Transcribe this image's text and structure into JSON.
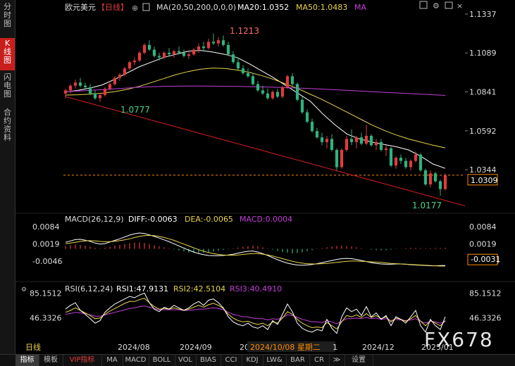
{
  "sidebar": {
    "items": [
      {
        "label": "分\n时\n图",
        "active": false
      },
      {
        "label": "K\n线\n图",
        "active": true
      },
      {
        "label": "闪\n电\n图",
        "active": false
      },
      {
        "label": "合\n约\n资\n料",
        "active": false
      }
    ]
  },
  "header": {
    "symbol": "欧元美元",
    "period": "【日线】",
    "ma_text": "MA(20,50,200,0,0,0)",
    "ma20_text": "MA20:1.0352",
    "ma50_text": "MA50:1.0483",
    "ma200_text": "MA"
  },
  "macd_header": {
    "title": "MACD(26,12,9)",
    "diff": "DIFF:-0.0063",
    "dea": "DEA:-0.0065",
    "macd": "MACD:0.0004"
  },
  "rsi_header": {
    "title": "RSI(6,12,24)",
    "rsi1": "RSI1:47.9131",
    "rsi2": "RSI2:42.5104",
    "rsi3": "RSI3:40.4910"
  },
  "price_axis": {
    "ticks": [
      "1.1337",
      "1.1089",
      "1.0841",
      "1.0592",
      "1.0344"
    ],
    "tick_values": [
      1.1337,
      1.1089,
      1.0841,
      1.0592,
      1.0344
    ],
    "current": "1.0309",
    "current_value": 1.0309
  },
  "macd_axis": {
    "ticks": [
      "0.0084",
      "0.0019",
      "-0.0046"
    ],
    "tick_values": [
      0.0084,
      0.0019,
      -0.0046
    ],
    "current": "-0.0031"
  },
  "rsi_axis": {
    "ticks": [
      "85.1512",
      "46.3326"
    ],
    "tick_values": [
      85.1512,
      46.3326
    ]
  },
  "annotations": {
    "high": "1.1213",
    "low_mid": "1.0777",
    "low_end": "1.0177"
  },
  "time_axis": {
    "labels": [
      "2024/08",
      "2024/09",
      "20",
      "2024/10/08 星期二",
      "1",
      "2024/12",
      "2025/01"
    ]
  },
  "cursor_date": "2024/10/08 星期二",
  "period_label": "日线",
  "watermark": "FX678",
  "bottom_tabs": [
    "指标",
    "模板",
    "VIP指标",
    "MA",
    "MACD",
    "BOLL",
    "VOL",
    "BIAS",
    "CCI",
    "KDJ",
    "LW&",
    "BAR",
    "CR",
    "≫",
    "设置"
  ],
  "colors": {
    "up": "#e23b3b",
    "down": "#2fb37e",
    "ma20": "#ffffff",
    "ma50": "#e8d44a",
    "ma200": "#c23fd9",
    "trend": "#e02020",
    "cursor": "#ff8a00",
    "annotation_high": "#ff6b6b",
    "annotation_low": "#4ad48a",
    "current_box": "#ff8a00"
  },
  "chart_data": {
    "type": "candlestick",
    "price_range": [
      1.0115,
      1.1337
    ],
    "macd_range": [
      -0.0065,
      0.0084
    ],
    "rsi_range": [
      15,
      90
    ],
    "grid": false,
    "series": [
      {
        "name": "MA20",
        "values": [
          1.084,
          1.085,
          1.0865,
          1.0885,
          1.092,
          1.096,
          1.1,
          1.103,
          1.106,
          1.108,
          1.11,
          1.1105,
          1.1095,
          1.108,
          1.106,
          1.102,
          1.0975,
          1.093,
          1.088,
          1.083,
          1.078,
          1.07,
          1.063,
          1.057,
          1.054,
          1.052,
          1.0505,
          1.049,
          1.047,
          1.043,
          1.038,
          1.0352
        ]
      },
      {
        "name": "MA50",
        "values": [
          1.082,
          1.0822,
          1.0826,
          1.0832,
          1.0842,
          1.0856,
          1.0875,
          1.09,
          1.0925,
          1.095,
          1.097,
          1.0985,
          1.0992,
          1.099,
          1.098,
          1.0965,
          1.0945,
          1.092,
          1.089,
          1.086,
          1.0825,
          1.079,
          1.075,
          1.071,
          1.067,
          1.063,
          1.0595,
          1.0565,
          1.054,
          1.052,
          1.05,
          1.0483
        ]
      },
      {
        "name": "MA200",
        "values": [
          1.0842,
          1.0846,
          1.085,
          1.0855,
          1.086,
          1.0865,
          1.087,
          1.0873,
          1.0876,
          1.0877,
          1.0878,
          1.0878,
          1.0877,
          1.0876,
          1.0875,
          1.0874,
          1.0872,
          1.087,
          1.0867,
          1.0865,
          1.0862,
          1.0858,
          1.0854,
          1.085,
          1.0846,
          1.0842,
          1.0838,
          1.0834,
          1.083,
          1.0826,
          1.0822,
          1.0818
        ]
      }
    ],
    "candles": [
      {
        "o": 1.083,
        "h": 1.086,
        "l": 1.08,
        "c": 1.085
      },
      {
        "o": 1.085,
        "h": 1.089,
        "l": 1.083,
        "c": 1.088
      },
      {
        "o": 1.088,
        "h": 1.092,
        "l": 1.086,
        "c": 1.09
      },
      {
        "o": 1.09,
        "h": 1.093,
        "l": 1.087,
        "c": 1.088
      },
      {
        "o": 1.088,
        "h": 1.09,
        "l": 1.086,
        "c": 1.087
      },
      {
        "o": 1.087,
        "h": 1.089,
        "l": 1.082,
        "c": 1.083
      },
      {
        "o": 1.083,
        "h": 1.085,
        "l": 1.079,
        "c": 1.08
      },
      {
        "o": 1.08,
        "h": 1.083,
        "l": 1.0777,
        "c": 1.082
      },
      {
        "o": 1.082,
        "h": 1.087,
        "l": 1.081,
        "c": 1.086
      },
      {
        "o": 1.086,
        "h": 1.09,
        "l": 1.085,
        "c": 1.089
      },
      {
        "o": 1.089,
        "h": 1.094,
        "l": 1.088,
        "c": 1.093
      },
      {
        "o": 1.093,
        "h": 1.096,
        "l": 1.091,
        "c": 1.095
      },
      {
        "o": 1.095,
        "h": 1.1,
        "l": 1.094,
        "c": 1.099
      },
      {
        "o": 1.099,
        "h": 1.104,
        "l": 1.098,
        "c": 1.103
      },
      {
        "o": 1.103,
        "h": 1.106,
        "l": 1.101,
        "c": 1.104
      },
      {
        "o": 1.104,
        "h": 1.11,
        "l": 1.103,
        "c": 1.109
      },
      {
        "o": 1.109,
        "h": 1.115,
        "l": 1.108,
        "c": 1.114
      },
      {
        "o": 1.114,
        "h": 1.117,
        "l": 1.11,
        "c": 1.111
      },
      {
        "o": 1.111,
        "h": 1.113,
        "l": 1.106,
        "c": 1.107
      },
      {
        "o": 1.107,
        "h": 1.109,
        "l": 1.104,
        "c": 1.106
      },
      {
        "o": 1.106,
        "h": 1.11,
        "l": 1.105,
        "c": 1.109
      },
      {
        "o": 1.109,
        "h": 1.112,
        "l": 1.107,
        "c": 1.108
      },
      {
        "o": 1.108,
        "h": 1.111,
        "l": 1.106,
        "c": 1.11
      },
      {
        "o": 1.11,
        "h": 1.113,
        "l": 1.108,
        "c": 1.109
      },
      {
        "o": 1.109,
        "h": 1.111,
        "l": 1.106,
        "c": 1.107
      },
      {
        "o": 1.107,
        "h": 1.11,
        "l": 1.105,
        "c": 1.108
      },
      {
        "o": 1.108,
        "h": 1.112,
        "l": 1.107,
        "c": 1.111
      },
      {
        "o": 1.111,
        "h": 1.115,
        "l": 1.109,
        "c": 1.113
      },
      {
        "o": 1.113,
        "h": 1.116,
        "l": 1.11,
        "c": 1.112
      },
      {
        "o": 1.112,
        "h": 1.118,
        "l": 1.111,
        "c": 1.116
      },
      {
        "o": 1.116,
        "h": 1.1213,
        "l": 1.114,
        "c": 1.115
      },
      {
        "o": 1.115,
        "h": 1.119,
        "l": 1.113,
        "c": 1.117
      },
      {
        "o": 1.117,
        "h": 1.12,
        "l": 1.113,
        "c": 1.114
      },
      {
        "o": 1.114,
        "h": 1.116,
        "l": 1.107,
        "c": 1.108
      },
      {
        "o": 1.108,
        "h": 1.11,
        "l": 1.102,
        "c": 1.103
      },
      {
        "o": 1.103,
        "h": 1.106,
        "l": 1.098,
        "c": 1.099
      },
      {
        "o": 1.099,
        "h": 1.101,
        "l": 1.095,
        "c": 1.096
      },
      {
        "o": 1.096,
        "h": 1.099,
        "l": 1.093,
        "c": 1.094
      },
      {
        "o": 1.094,
        "h": 1.096,
        "l": 1.088,
        "c": 1.089
      },
      {
        "o": 1.089,
        "h": 1.091,
        "l": 1.084,
        "c": 1.085
      },
      {
        "o": 1.085,
        "h": 1.088,
        "l": 1.082,
        "c": 1.083
      },
      {
        "o": 1.083,
        "h": 1.086,
        "l": 1.079,
        "c": 1.08
      },
      {
        "o": 1.08,
        "h": 1.085,
        "l": 1.079,
        "c": 1.084
      },
      {
        "o": 1.084,
        "h": 1.086,
        "l": 1.08,
        "c": 1.081
      },
      {
        "o": 1.081,
        "h": 1.088,
        "l": 1.08,
        "c": 1.087
      },
      {
        "o": 1.087,
        "h": 1.095,
        "l": 1.086,
        "c": 1.094
      },
      {
        "o": 1.094,
        "h": 1.096,
        "l": 1.088,
        "c": 1.089
      },
      {
        "o": 1.089,
        "h": 1.09,
        "l": 1.078,
        "c": 1.079
      },
      {
        "o": 1.079,
        "h": 1.081,
        "l": 1.07,
        "c": 1.071
      },
      {
        "o": 1.071,
        "h": 1.073,
        "l": 1.064,
        "c": 1.065
      },
      {
        "o": 1.065,
        "h": 1.067,
        "l": 1.058,
        "c": 1.059
      },
      {
        "o": 1.059,
        "h": 1.061,
        "l": 1.054,
        "c": 1.055
      },
      {
        "o": 1.055,
        "h": 1.058,
        "l": 1.05,
        "c": 1.052
      },
      {
        "o": 1.052,
        "h": 1.056,
        "l": 1.048,
        "c": 1.054
      },
      {
        "o": 1.054,
        "h": 1.057,
        "l": 1.046,
        "c": 1.047
      },
      {
        "o": 1.047,
        "h": 1.048,
        "l": 1.034,
        "c": 1.036
      },
      {
        "o": 1.036,
        "h": 1.048,
        "l": 1.035,
        "c": 1.047
      },
      {
        "o": 1.047,
        "h": 1.056,
        "l": 1.046,
        "c": 1.054
      },
      {
        "o": 1.054,
        "h": 1.06,
        "l": 1.05,
        "c": 1.052
      },
      {
        "o": 1.052,
        "h": 1.056,
        "l": 1.048,
        "c": 1.055
      },
      {
        "o": 1.055,
        "h": 1.058,
        "l": 1.05,
        "c": 1.051
      },
      {
        "o": 1.051,
        "h": 1.063,
        "l": 1.05,
        "c": 1.056
      },
      {
        "o": 1.056,
        "h": 1.057,
        "l": 1.049,
        "c": 1.05
      },
      {
        "o": 1.05,
        "h": 1.054,
        "l": 1.047,
        "c": 1.052
      },
      {
        "o": 1.052,
        "h": 1.054,
        "l": 1.046,
        "c": 1.047
      },
      {
        "o": 1.047,
        "h": 1.05,
        "l": 1.043,
        "c": 1.048
      },
      {
        "o": 1.048,
        "h": 1.049,
        "l": 1.036,
        "c": 1.037
      },
      {
        "o": 1.037,
        "h": 1.043,
        "l": 1.035,
        "c": 1.042
      },
      {
        "o": 1.042,
        "h": 1.044,
        "l": 1.038,
        "c": 1.04
      },
      {
        "o": 1.04,
        "h": 1.042,
        "l": 1.035,
        "c": 1.036
      },
      {
        "o": 1.036,
        "h": 1.041,
        "l": 1.034,
        "c": 1.04
      },
      {
        "o": 1.04,
        "h": 1.046,
        "l": 1.039,
        "c": 1.044
      },
      {
        "o": 1.044,
        "h": 1.045,
        "l": 1.033,
        "c": 1.034
      },
      {
        "o": 1.034,
        "h": 1.035,
        "l": 1.024,
        "c": 1.025
      },
      {
        "o": 1.025,
        "h": 1.034,
        "l": 1.023,
        "c": 1.032
      },
      {
        "o": 1.032,
        "h": 1.033,
        "l": 1.026,
        "c": 1.027
      },
      {
        "o": 1.027,
        "h": 1.028,
        "l": 1.0177,
        "c": 1.022
      },
      {
        "o": 1.022,
        "h": 1.032,
        "l": 1.021,
        "c": 1.0309
      }
    ],
    "macd_hist": [
      0.001,
      0.0014,
      0.0016,
      0.0015,
      0.0012,
      0.0008,
      0.0004,
      0.0002,
      0.0004,
      0.0008,
      0.0012,
      0.0015,
      0.0018,
      0.0021,
      0.0023,
      0.0024,
      0.0022,
      0.0018,
      0.0014,
      0.001,
      0.0006,
      0.0002,
      -0.0002,
      -0.0006,
      -0.001,
      -0.0013,
      -0.0015,
      -0.0016,
      -0.0015,
      -0.0013,
      -0.001,
      -0.0007,
      -0.0004,
      -0.0001,
      0.0002,
      0.0005,
      0.0008,
      0.001,
      0.0012,
      0.001,
      0.0006,
      0.0002,
      -0.0003,
      -0.0008,
      -0.0012,
      -0.0015,
      -0.0017,
      -0.0016,
      -0.0013,
      -0.0009,
      -0.0005,
      -0.0001,
      0.0003,
      0.0006,
      0.0009,
      0.0011,
      0.0012,
      0.0011,
      0.0009,
      0.0006,
      0.0003,
      0.0,
      -0.0003,
      -0.0005,
      -0.0006,
      -0.0005,
      -0.0003,
      -0.0001,
      0.0001,
      0.0003,
      0.0004,
      0.0004,
      0.0003,
      0.0002,
      0.0003,
      0.0004,
      0.0004,
      0.0004
    ],
    "macd_diff": [
      0.0025,
      0.003,
      0.0035,
      0.0036,
      0.0033,
      0.0028,
      0.0022,
      0.0018,
      0.002,
      0.0026,
      0.0032,
      0.0038,
      0.0045,
      0.0052,
      0.0057,
      0.006,
      0.0058,
      0.0053,
      0.0047,
      0.0041,
      0.0034,
      0.0027,
      0.0019,
      0.0011,
      0.0003,
      -0.0005,
      -0.0012,
      -0.0018,
      -0.0022,
      -0.0025,
      -0.0026,
      -0.0026,
      -0.0025,
      -0.0023,
      -0.002,
      -0.0016,
      -0.0012,
      -0.0009,
      -0.0008,
      -0.0012,
      -0.0018,
      -0.0025,
      -0.0033,
      -0.0041,
      -0.0048,
      -0.0054,
      -0.0058,
      -0.0061,
      -0.0062,
      -0.0061,
      -0.0059,
      -0.0056,
      -0.0052,
      -0.0048,
      -0.0044,
      -0.004,
      -0.0037,
      -0.0036,
      -0.0037,
      -0.004,
      -0.0044,
      -0.0048,
      -0.0052,
      -0.0055,
      -0.0057,
      -0.0058,
      -0.0058,
      -0.0057,
      -0.0057,
      -0.0058,
      -0.006,
      -0.0061,
      -0.0062,
      -0.0063,
      -0.0064,
      -0.0064,
      -0.0063,
      -0.0063
    ],
    "macd_dea": [
      0.002,
      0.0022,
      0.0025,
      0.0028,
      0.003,
      0.0031,
      0.003,
      0.0028,
      0.0027,
      0.0027,
      0.0029,
      0.0031,
      0.0034,
      0.0038,
      0.0043,
      0.0047,
      0.005,
      0.0051,
      0.005,
      0.0047,
      0.0043,
      0.0038,
      0.0032,
      0.0025,
      0.0018,
      0.0011,
      0.0004,
      -0.0003,
      -0.0009,
      -0.0014,
      -0.0018,
      -0.0021,
      -0.0023,
      -0.0024,
      -0.0024,
      -0.0023,
      -0.0021,
      -0.0019,
      -0.0018,
      -0.0018,
      -0.002,
      -0.0023,
      -0.0027,
      -0.0032,
      -0.0037,
      -0.0042,
      -0.0047,
      -0.0051,
      -0.0054,
      -0.0056,
      -0.0057,
      -0.0057,
      -0.0056,
      -0.0055,
      -0.0053,
      -0.0051,
      -0.0049,
      -0.0047,
      -0.0046,
      -0.0046,
      -0.0047,
      -0.0048,
      -0.0049,
      -0.005,
      -0.0051,
      -0.0053,
      -0.0055,
      -0.0056,
      -0.0057,
      -0.0058,
      -0.0059,
      -0.006,
      -0.0061,
      -0.0062,
      -0.0063,
      -0.0064,
      -0.0065,
      -0.0065
    ],
    "rsi1": [
      60,
      66,
      70,
      58,
      52,
      45,
      38,
      42,
      55,
      62,
      68,
      72,
      76,
      80,
      78,
      82,
      85,
      70,
      60,
      56,
      63,
      60,
      66,
      62,
      58,
      62,
      68,
      72,
      66,
      74,
      76,
      70,
      62,
      48,
      40,
      36,
      34,
      38,
      32,
      30,
      34,
      28,
      42,
      36,
      52,
      68,
      56,
      38,
      30,
      26,
      24,
      28,
      26,
      44,
      30,
      22,
      48,
      62,
      56,
      60,
      50,
      64,
      48,
      54,
      44,
      50,
      34,
      48,
      44,
      38,
      48,
      58,
      34,
      24,
      44,
      34,
      28,
      48
    ],
    "rsi2": [
      55,
      58,
      62,
      58,
      54,
      50,
      45,
      46,
      52,
      57,
      61,
      65,
      69,
      72,
      72,
      75,
      77,
      70,
      64,
      60,
      61,
      60,
      62,
      60,
      58,
      60,
      63,
      66,
      63,
      67,
      69,
      66,
      61,
      52,
      46,
      42,
      40,
      41,
      38,
      36,
      38,
      34,
      40,
      38,
      46,
      56,
      52,
      44,
      38,
      34,
      31,
      32,
      31,
      39,
      34,
      29,
      40,
      50,
      48,
      51,
      47,
      53,
      47,
      50,
      45,
      48,
      40,
      46,
      44,
      41,
      45,
      50,
      41,
      34,
      42,
      38,
      34,
      42
    ],
    "rsi3": [
      52,
      53,
      55,
      54,
      53,
      51,
      49,
      49,
      51,
      53,
      55,
      57,
      59,
      61,
      62,
      64,
      65,
      63,
      61,
      59,
      59,
      59,
      59,
      59,
      58,
      58,
      59,
      60,
      60,
      61,
      62,
      61,
      59,
      55,
      52,
      50,
      48,
      48,
      46,
      45,
      45,
      43,
      45,
      44,
      47,
      51,
      50,
      47,
      44,
      42,
      40,
      40,
      39,
      42,
      40,
      37,
      41,
      45,
      45,
      46,
      45,
      47,
      45,
      46,
      44,
      45,
      42,
      44,
      43,
      42,
      43,
      45,
      41,
      38,
      41,
      40,
      38,
      40
    ],
    "trendline": {
      "from": {
        "index": 0,
        "value": 1.081
      },
      "to": {
        "index": 78,
        "value": 1.014
      }
    }
  }
}
